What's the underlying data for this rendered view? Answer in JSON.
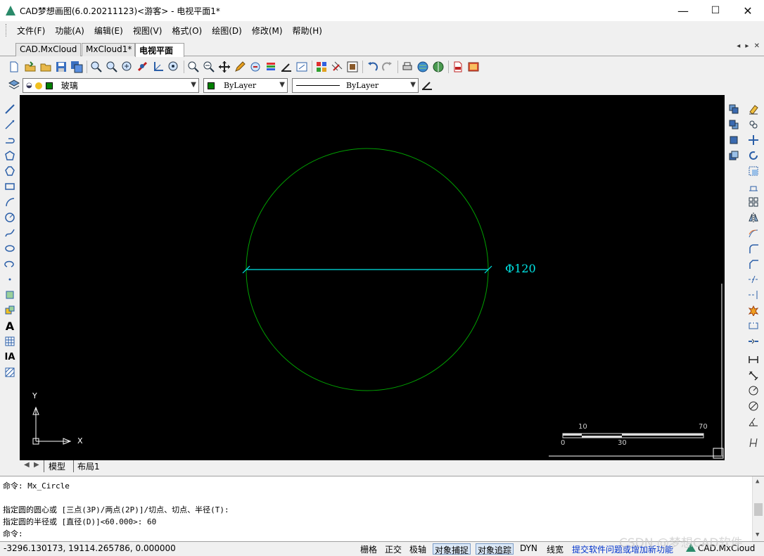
{
  "window": {
    "title": "CAD梦想画图(6.0.20211123)<游客> - 电视平面1*",
    "minimize": "—",
    "maximize": "☐",
    "close": "✕"
  },
  "menu": [
    "文件(F)",
    "功能(A)",
    "编辑(E)",
    "视图(V)",
    "格式(O)",
    "绘图(D)",
    "修改(M)",
    "帮助(H)"
  ],
  "tabs": [
    {
      "label": "CAD.MxCloud",
      "active": false
    },
    {
      "label": "MxCloud1*",
      "active": false
    },
    {
      "label": "电视平面1*",
      "active": true
    }
  ],
  "tab_nav": "◂ ▸ ✕",
  "properties": {
    "layer": "玻璃",
    "color": "ByLayer",
    "linetype": "ByLayer"
  },
  "drawing": {
    "dimension_text": "Φ120",
    "ucs_y": "Y",
    "ucs_x": "X",
    "scale_labels": {
      "top_left": "10",
      "top_right": "70",
      "bottom_left": "0",
      "bottom_mid": "30"
    },
    "circle_color": "#00a000",
    "dim_color": "#00e5e5"
  },
  "layout_tabs": [
    "模型",
    "布局1"
  ],
  "command_lines": [
    "命令: Mx_Circle",
    "",
    "指定圆的圆心或 [三点(3P)/两点(2P)]/切点、切点、半径(T):",
    "指定圆的半径或 [直径(D)]<60.000>: 60",
    "命令:"
  ],
  "status": {
    "coords": "-3296.130173,  19114.265786,  0.000000",
    "toggles": [
      {
        "label": "栅格",
        "on": false
      },
      {
        "label": "正交",
        "on": false
      },
      {
        "label": "极轴",
        "on": false
      },
      {
        "label": "对象捕捉",
        "on": true
      },
      {
        "label": "对象追踪",
        "on": true
      },
      {
        "label": "DYN",
        "on": false
      },
      {
        "label": "线宽",
        "on": false
      }
    ],
    "feedback_link": "提交软件问题或增加新功能",
    "brand": "CAD.MxCloud"
  },
  "watermark": "CSDN @梦想CAD软件"
}
